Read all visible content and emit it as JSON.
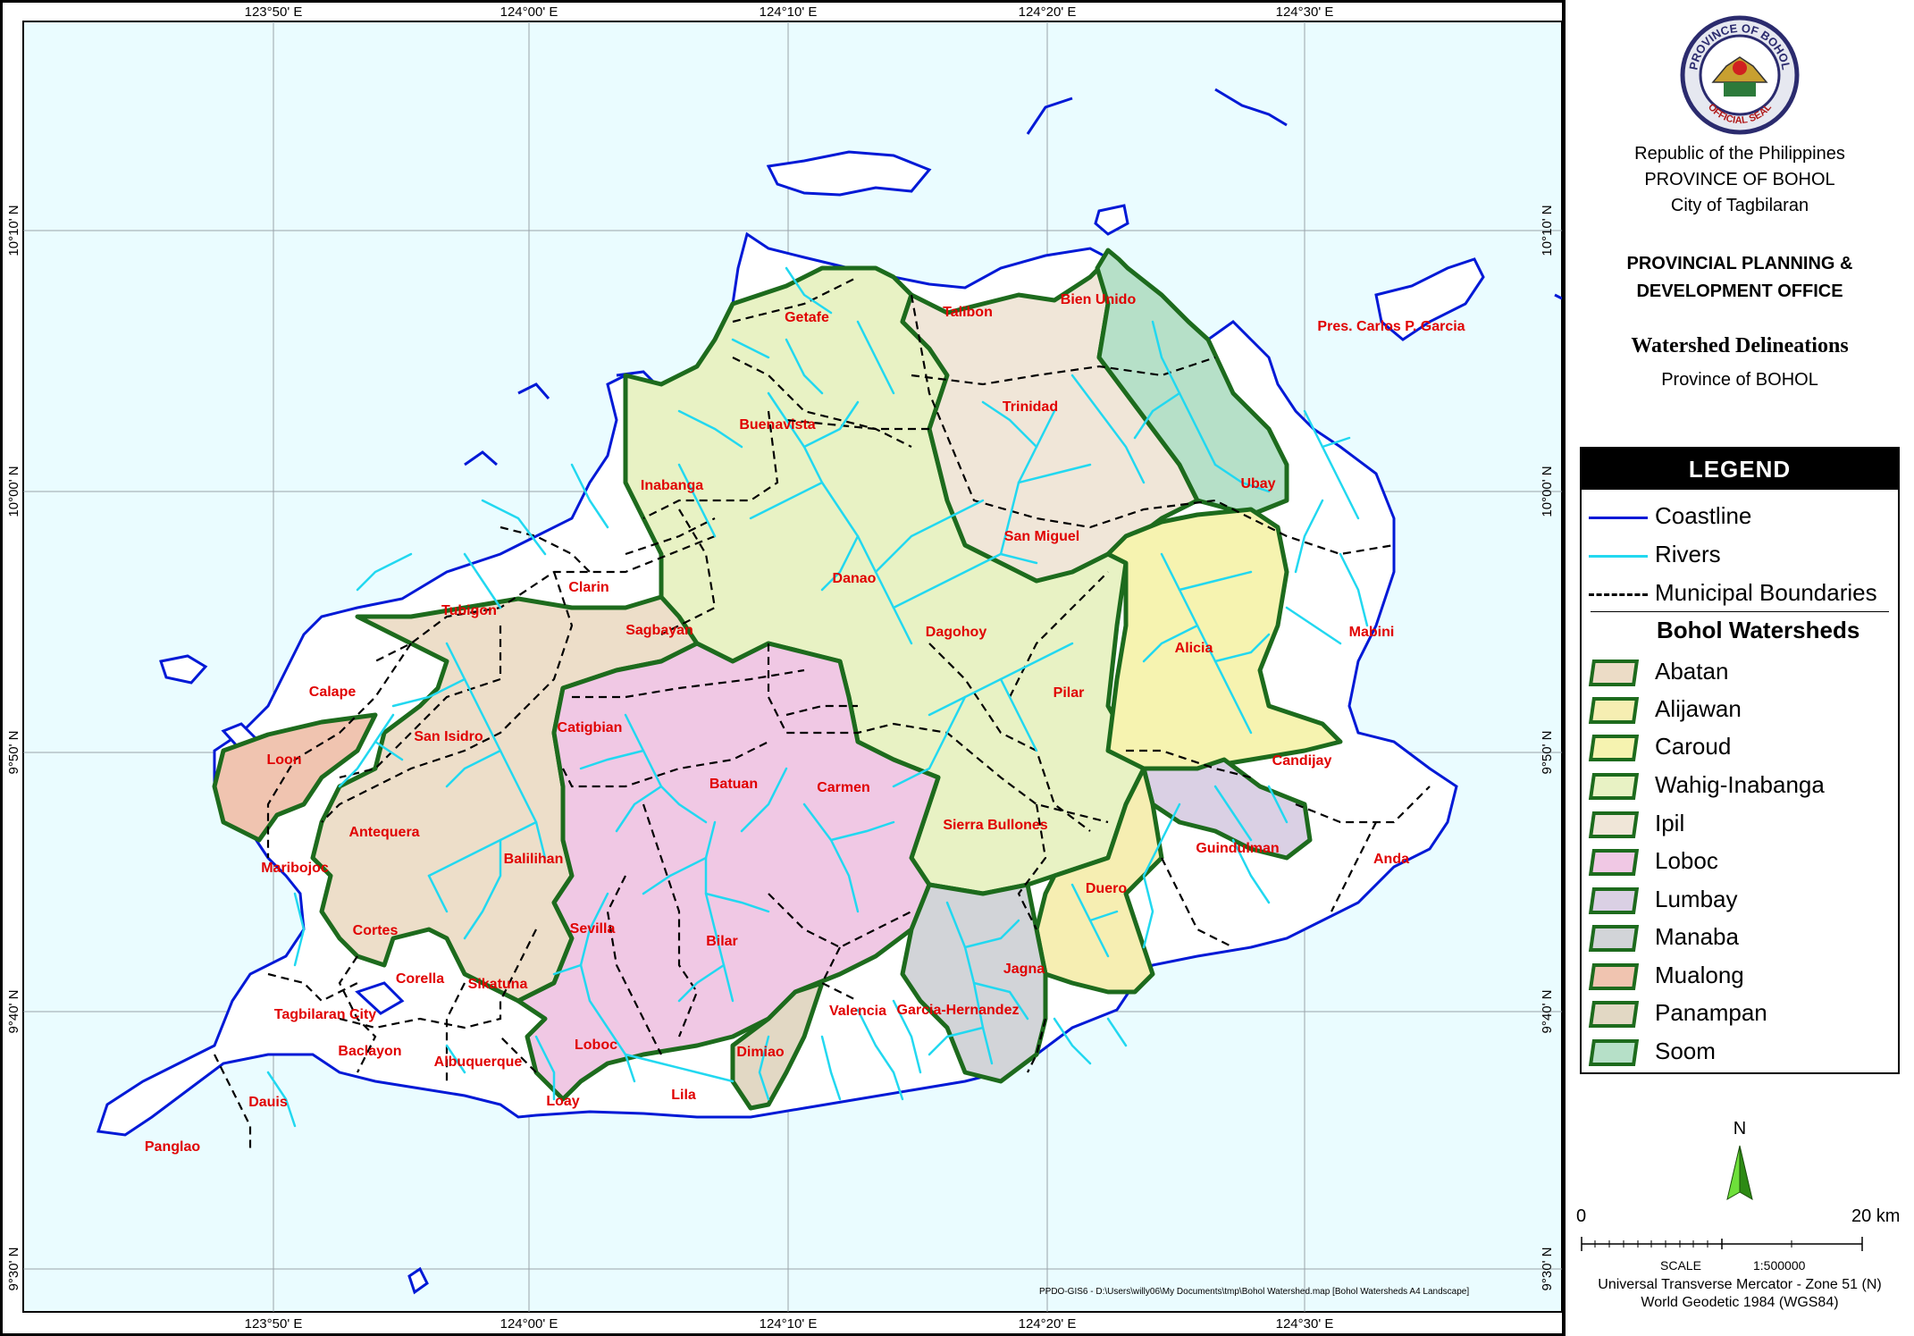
{
  "map": {
    "top_longitudes": [
      "123°50' E",
      "124°00' E",
      "124°10' E",
      "124°20' E",
      "124°30' E"
    ],
    "bottom_longitudes": [
      "123°50' E",
      "124°00' E",
      "124°10' E",
      "124°20' E",
      "124°30' E"
    ],
    "left_latitudes": [
      "10°10' N",
      "10°00' N",
      "9°50' N",
      "9°40' N",
      "9°30' N"
    ],
    "right_latitudes": [
      "10°10' N",
      "10°00' N",
      "9°50' N",
      "9°40' N",
      "9°30' N"
    ],
    "municipalities": [
      "Getafe",
      "Talibon",
      "Bien Unido",
      "Pres. Carlos P. Garcia",
      "Buenavista",
      "Trinidad",
      "Inabanga",
      "Ubay",
      "San Miguel",
      "Danao",
      "Clarin",
      "Tubigon",
      "Sagbayan",
      "Dagohoy",
      "Alicia",
      "Mabini",
      "Calape",
      "San Isidro",
      "Catigbian",
      "Pilar",
      "Loon",
      "Batuan",
      "Carmen",
      "Candijay",
      "Antequera",
      "Sierra Bullones",
      "Guindulman",
      "Maribojoc",
      "Balilihan",
      "Anda",
      "Duero",
      "Cortes",
      "Sevilla",
      "Bilar",
      "Corella",
      "Sikatuna",
      "Jagna",
      "Tagbilaran City",
      "Valencia",
      "Garcia-Hernandez",
      "Baclayon",
      "Loboc",
      "Dimiao",
      "Albuquerque",
      "Dauis",
      "Loay",
      "Lila",
      "Panglao"
    ],
    "file_path": "PPDO-GIS6 - D:\\Users\\willy06\\My Documents\\tmp\\Bohol Watershed.map [Bohol Watersheds A4 Landscape]"
  },
  "seal": {
    "top_text": "PROVINCE OF BOHOL",
    "bottom_text": "OFFICIAL SEAL"
  },
  "header": {
    "line1": "Republic of the Philippines",
    "line2": "PROVINCE OF BOHOL",
    "line3": "City of Tagbilaran",
    "office_line1": "PROVINCIAL PLANNING &",
    "office_line2": "DEVELOPMENT OFFICE",
    "title": "Watershed Delineations",
    "subtitle": "Province of BOHOL"
  },
  "legend": {
    "title": "LEGEND",
    "line_items": [
      {
        "label": "Coastline",
        "color": "#0019d6",
        "dashed": false
      },
      {
        "label": "Rivers",
        "color": "#22d8f0",
        "dashed": false
      },
      {
        "label": "Municipal Boundaries",
        "color": "#000000",
        "dashed": true
      }
    ],
    "watershed_heading": "Bohol Watersheds",
    "watersheds": [
      {
        "name": "Abatan",
        "color": "#ecdcc6"
      },
      {
        "name": "Alijawan",
        "color": "#f6eeb2"
      },
      {
        "name": "Caroud",
        "color": "#f6f3b0"
      },
      {
        "name": "Wahig-Inabanga",
        "color": "#e8f2c4"
      },
      {
        "name": "Ipil",
        "color": "#f0e6d8"
      },
      {
        "name": "Loboc",
        "color": "#f0c8e4"
      },
      {
        "name": "Lumbay",
        "color": "#dad0e4"
      },
      {
        "name": "Manaba",
        "color": "#d2d4d8"
      },
      {
        "name": "Mualong",
        "color": "#f0c4b0"
      },
      {
        "name": "Panampan",
        "color": "#e2d8c4"
      },
      {
        "name": "Soom",
        "color": "#b6e0c8"
      }
    ]
  },
  "north_arrow": {
    "label": "N",
    "color": "#44cc22"
  },
  "scale": {
    "zero": "0",
    "max": "20 km",
    "label": "SCALE",
    "ratio": "1:500000"
  },
  "projection": {
    "line1": "Universal Transverse Mercator - Zone 51 (N)",
    "line2": "World Geodetic 1984 (WGS84)"
  },
  "colors": {
    "sea": "#eafcff",
    "land": "#ffffff",
    "coast": "#0019d6",
    "river": "#22d8f0",
    "watershed_border": "#1d6b1d",
    "label": "#e00000"
  }
}
